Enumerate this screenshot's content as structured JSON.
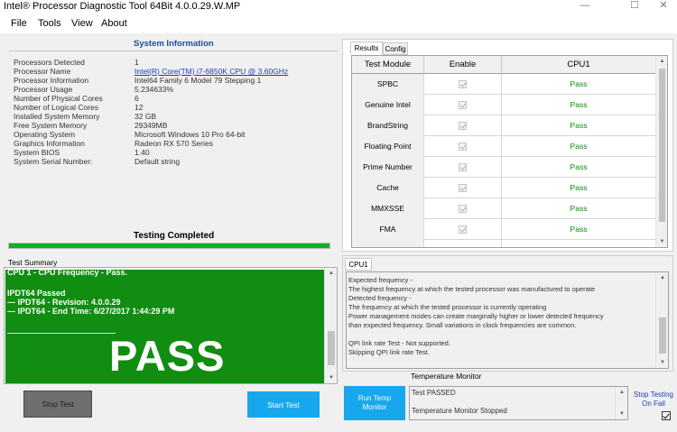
{
  "window": {
    "title": "Intel® Processor Diagnostic Tool 64Bit 4.0.0.29.W.MP",
    "minimize_icon": "minimize-icon",
    "maximize_icon": "maximize-icon",
    "close_icon": "close-icon"
  },
  "menu": [
    "File",
    "Tools",
    "View",
    "About"
  ],
  "system_info": {
    "title": "System Information",
    "rows": [
      {
        "label": "Processors Detected",
        "value": "1"
      },
      {
        "label": "Processor Name",
        "value": "Intel(R) Core(TM) i7-6850K CPU @ 3.60GHz"
      },
      {
        "label": "Processor Information",
        "value": "Intel64 Family 6 Model 79 Stepping 1"
      },
      {
        "label": "Processor Usage",
        "value": "5.234633%"
      },
      {
        "label": "Number of Physical Cores",
        "value": "6"
      },
      {
        "label": "Number of Logical Cores",
        "value": "12"
      },
      {
        "label": "Installed System Memory",
        "value": "32 GB"
      },
      {
        "label": "Free System Memory",
        "value": "29349MB"
      },
      {
        "label": "Operating System",
        "value": "Microsoft Windows 10 Pro 64-bit"
      },
      {
        "label": "Graphics Information",
        "value": "Radeon RX 570 Series"
      },
      {
        "label": "System BIOS",
        "value": "1.40"
      },
      {
        "label": "System Serial Number:",
        "value": "Default string"
      }
    ]
  },
  "status": {
    "label": "Testing Completed",
    "progress_percent": 100,
    "progress_color": "#06b025"
  },
  "test_summary": {
    "label": "Test Summary",
    "lines": [
      "CPU 1 - CPU Frequency - Pass.",
      "IPDT64 Passed",
      "--- IPDT64 - Revision: 4.0.0.29",
      "--- IPDT64 - End Time: 6/27/2017 1:44:29 PM"
    ],
    "result": "PASS",
    "background_color": "#118d11"
  },
  "buttons": {
    "stop_test": "Stop Test",
    "start_test": "Start Test",
    "run_temp_monitor_line1": "Run Temp",
    "run_temp_monitor_line2": "Monitor"
  },
  "tabs": {
    "results": "Results",
    "config": "Config",
    "cpu1": "CPU1"
  },
  "results_grid": {
    "headers": [
      "Test Module",
      "Enable",
      "CPU1"
    ],
    "rows": [
      {
        "module": "SPBC",
        "enabled": true,
        "cpu1": "Pass"
      },
      {
        "module": "Genuine Intel",
        "enabled": true,
        "cpu1": "Pass"
      },
      {
        "module": "BrandString",
        "enabled": true,
        "cpu1": "Pass"
      },
      {
        "module": "Floating Point",
        "enabled": true,
        "cpu1": "Pass"
      },
      {
        "module": "Prime Number",
        "enabled": true,
        "cpu1": "Pass"
      },
      {
        "module": "Cache",
        "enabled": true,
        "cpu1": "Pass"
      },
      {
        "module": "MMXSSE",
        "enabled": true,
        "cpu1": "Pass"
      },
      {
        "module": "FMA",
        "enabled": true,
        "cpu1": "Pass"
      }
    ],
    "pass_color": "#0a8a0a"
  },
  "cpu1_log": {
    "lines": [
      "Expected frequency -",
      "The highest frequency at which the tested processor was manufactured to operate",
      "Detected frequency -",
      "The frequency at which the tested processor is currently operating",
      "Power management modes can create marginally higher or lower detected frequency",
      "than expected frequency. Small variations in clock frequencies are common.",
      "",
      "QPI link rate Test - Not supported.",
      "Skipping QPI link rate Test."
    ]
  },
  "temperature_monitor": {
    "title": "Temperature Monitor",
    "lines": [
      "Test PASSED",
      "Temperature Monitor Stopped"
    ]
  },
  "stop_testing_on_fail": {
    "label_line1": "Stop Testing",
    "label_line2": "On Fail",
    "checked": true
  }
}
